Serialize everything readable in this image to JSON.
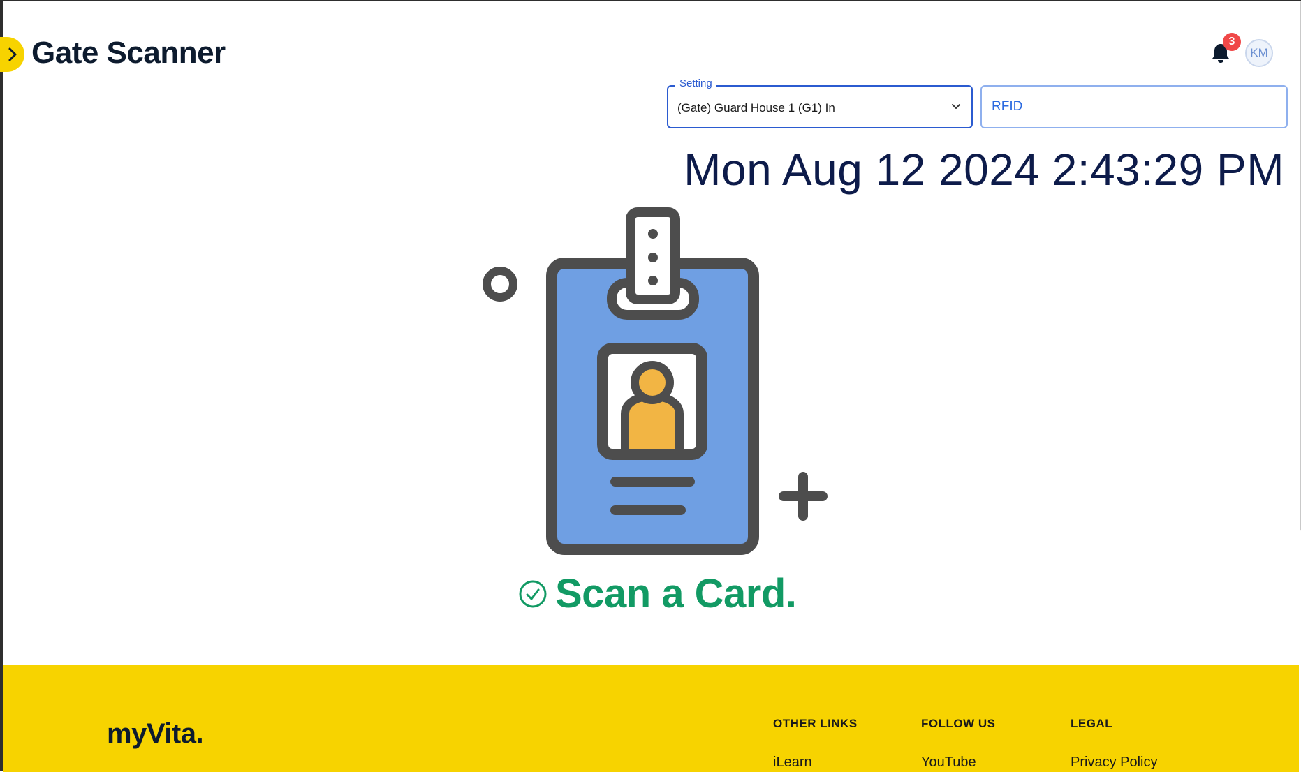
{
  "header": {
    "title": "Gate Scanner",
    "notifications": {
      "count": "3",
      "icon": "bell-icon"
    },
    "user": {
      "initials": "KM"
    }
  },
  "controls": {
    "setting": {
      "label": "Setting",
      "value": "(Gate) Guard House 1 (G1) In"
    },
    "rfid": {
      "placeholder": "RFID",
      "value": ""
    }
  },
  "datetime": "Mon Aug 12 2024 2:43:29 PM",
  "scanner": {
    "message": "Scan a Card.",
    "colors": {
      "card": "#6f9fe3",
      "outline": "#4d4d4d",
      "person": "#f2b544",
      "success": "#129a64"
    }
  },
  "footer": {
    "brand": "myVita.",
    "columns": [
      {
        "heading": "OTHER LINKS",
        "first_link": "iLearn"
      },
      {
        "heading": "FOLLOW US",
        "first_link": "YouTube"
      },
      {
        "heading": "LEGAL",
        "first_link": "Privacy Policy"
      }
    ],
    "background": "#f7d300"
  }
}
